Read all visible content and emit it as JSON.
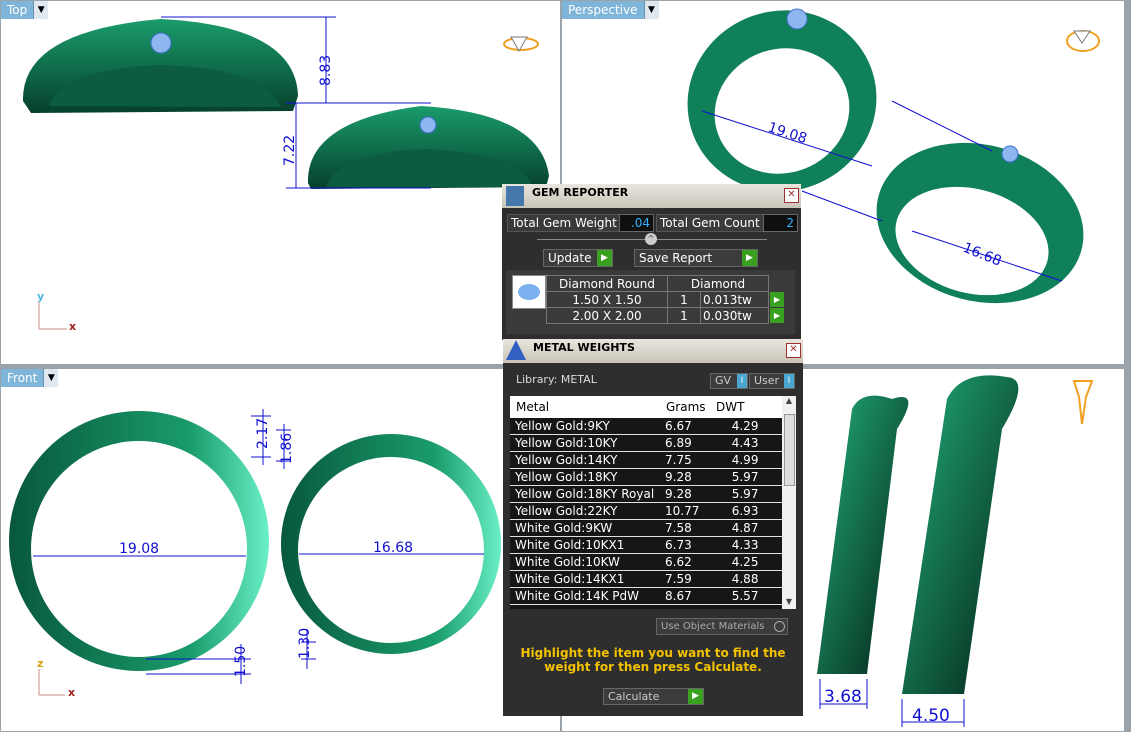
{
  "viewports": {
    "top": {
      "label": "Top",
      "axis_v": "y",
      "axis_h": "x"
    },
    "perspective": {
      "label": "Perspective"
    },
    "front": {
      "label": "Front",
      "axis_v": "z",
      "axis_h": "x"
    }
  },
  "dimensions": {
    "top_height_large": "8.83",
    "top_height_small": "7.22",
    "front_width_large": "2.17",
    "front_width_small": "1.86",
    "front_inner_large": "19.08",
    "front_inner_small": "16.68",
    "front_bottom_large": "1.50",
    "front_bottom_small": "1.30",
    "side_thickness_large": "3.68",
    "side_thickness_small": "4.50",
    "persp_dim_a": "19.08",
    "persp_dim_b": "16.68"
  },
  "gem_reporter": {
    "title": "GEM REPORTER",
    "total_gem_weight_label": "Total Gem Weight",
    "total_gem_weight": ".04",
    "total_gem_count_label": "Total Gem Count",
    "total_gem_count": "2",
    "update_label": "Update",
    "save_report_label": "Save Report",
    "header": {
      "shape": "Diamond Round",
      "material": "Diamond"
    },
    "rows": [
      {
        "size": "1.50 X 1.50",
        "count": "1",
        "weight": "0.013tw"
      },
      {
        "size": "2.00 X 2.00",
        "count": "1",
        "weight": "0.030tw"
      }
    ]
  },
  "metal_weights": {
    "title": "METAL WEIGHTS",
    "library_label": "Library: METAL",
    "gv_label": "GV",
    "user_label": "User",
    "columns": [
      "Metal",
      "Grams",
      "DWT"
    ],
    "rows": [
      {
        "metal": "Yellow Gold:9KY",
        "grams": "6.67",
        "dwt": "4.29"
      },
      {
        "metal": "Yellow Gold:10KY",
        "grams": "6.89",
        "dwt": "4.43"
      },
      {
        "metal": "Yellow Gold:14KY",
        "grams": "7.75",
        "dwt": "4.99"
      },
      {
        "metal": "Yellow Gold:18KY",
        "grams": "9.28",
        "dwt": "5.97"
      },
      {
        "metal": "Yellow Gold:18KY Royal",
        "grams": "9.28",
        "dwt": "5.97"
      },
      {
        "metal": "Yellow Gold:22KY",
        "grams": "10.77",
        "dwt": "6.93"
      },
      {
        "metal": "White Gold:9KW",
        "grams": "7.58",
        "dwt": "4.87"
      },
      {
        "metal": "White Gold:10KX1",
        "grams": "6.73",
        "dwt": "4.33"
      },
      {
        "metal": "White Gold:10KW",
        "grams": "6.62",
        "dwt": "4.25"
      },
      {
        "metal": "White Gold:14KX1",
        "grams": "7.59",
        "dwt": "4.88"
      },
      {
        "metal": "White Gold:14K PdW",
        "grams": "8.67",
        "dwt": "5.57"
      }
    ],
    "use_object_materials_label": "Use Object Materials",
    "hint": "Highlight the item you want to find the weight for then press Calculate.",
    "calculate_label": "Calculate"
  },
  "colors": {
    "ring_green": "#0e7a55",
    "dim_blue": "#1010d0",
    "accent_yellow": "#f2c200"
  }
}
